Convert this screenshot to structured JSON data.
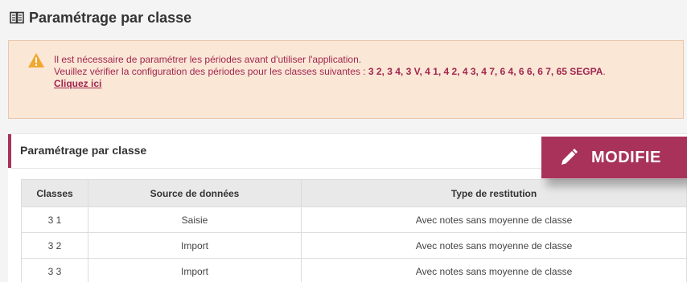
{
  "header": {
    "title": "Paramétrage par classe"
  },
  "alert": {
    "line1": "Il est nécessaire de paramétrer les périodes avant d'utiliser l'application.",
    "line2_prefix": "Veuillez vérifier la configuration des périodes pour les classes suivantes : ",
    "classes": "3 2, 3 4, 3 V, 4 1, 4 2, 4 3, 4 7, 6 4, 6 6, 6 7, 65 SEGPA",
    "line2_suffix": ".",
    "link_label": "Cliquez ici"
  },
  "card": {
    "title": "Paramétrage par classe",
    "modify_label": "MODIFIE"
  },
  "table": {
    "columns": [
      "Classes",
      "Source de données",
      "Type de restitution"
    ],
    "rows": [
      {
        "classe": "3 1",
        "source": "Saisie",
        "type": "Avec notes sans moyenne de classe"
      },
      {
        "classe": "3 2",
        "source": "Import",
        "type": "Avec notes sans moyenne de classe"
      },
      {
        "classe": "3 3",
        "source": "Import",
        "type": "Avec notes sans moyenne de classe"
      }
    ]
  },
  "colors": {
    "accent": "#a8325a",
    "alert_bg": "#fbe7d6",
    "alert_text": "#a0264f",
    "warning_icon": "#f0a830"
  },
  "icons": {
    "header": "book-open-icon",
    "alert": "warning-icon",
    "button": "pencil-icon"
  }
}
